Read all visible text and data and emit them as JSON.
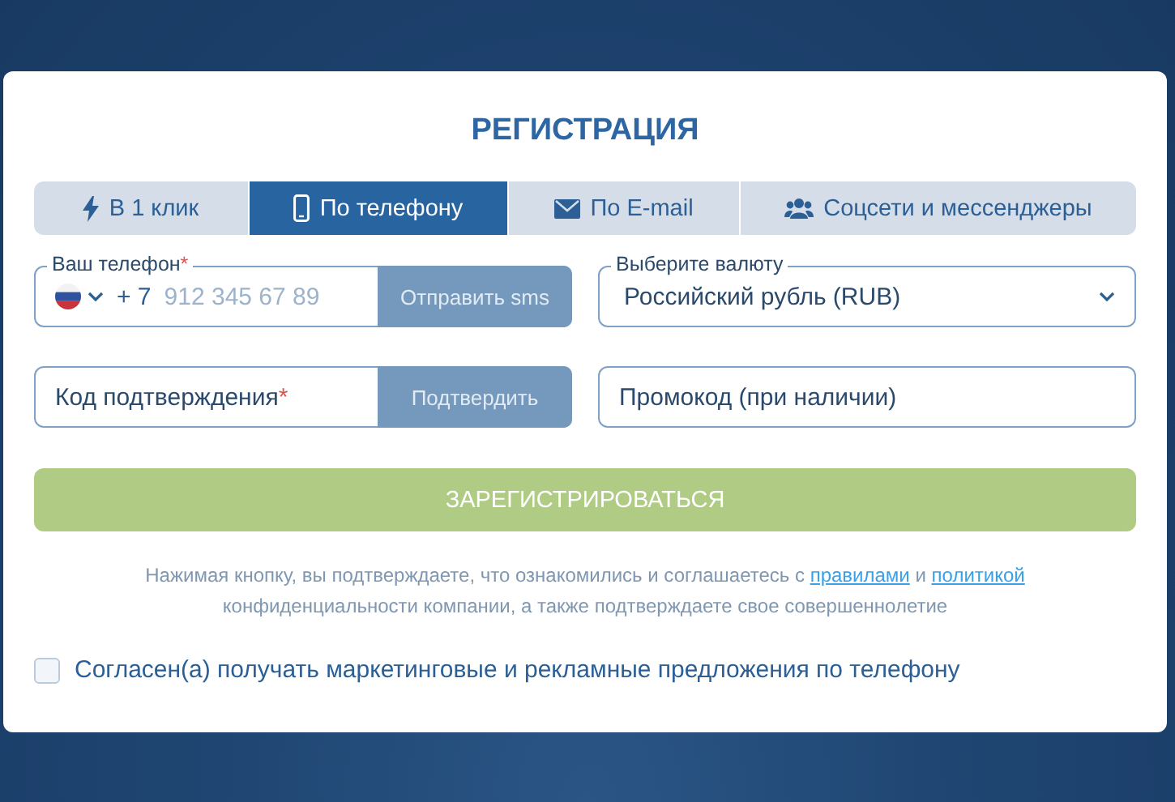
{
  "title": "РЕГИСТРАЦИЯ",
  "tabs": [
    {
      "label": "В 1 клик",
      "kind": "bolt",
      "selected": false
    },
    {
      "label": "По телефону",
      "kind": "phone",
      "selected": true
    },
    {
      "label": "По E-mail",
      "kind": "mail",
      "selected": false
    },
    {
      "label": "Соцсети и мессенджеры",
      "kind": "people",
      "selected": false
    }
  ],
  "phone": {
    "label": "Ваш телефон",
    "required_mark": "*",
    "code": "+ 7",
    "placeholder": "912 345 67 89",
    "button": "Отправить sms"
  },
  "currency": {
    "label": "Выберите валюту",
    "value": "Российский рубль (RUB)"
  },
  "code": {
    "placeholder": "Код подтверждения",
    "required_mark": "*",
    "button": "Подтвердить"
  },
  "promo": {
    "placeholder": "Промокод (при наличии)"
  },
  "register_button": {
    "label": "ЗАРЕГИСТРИРОВАТЬСЯ",
    "disabled": true
  },
  "notice": {
    "before": "Нажимая кнопку, вы подтверждаете, что ознакомились и соглашаетесь с",
    "link_rules": "правилами",
    "middle": "и",
    "link_policy": "политикой",
    "after": "конфиденциальности компании, а также подтверждаете свое совершеннолетие"
  },
  "marketing": {
    "label": "Согласен(а) получать маркетинговые и рекламные предложения по телефону",
    "checked": false
  }
}
